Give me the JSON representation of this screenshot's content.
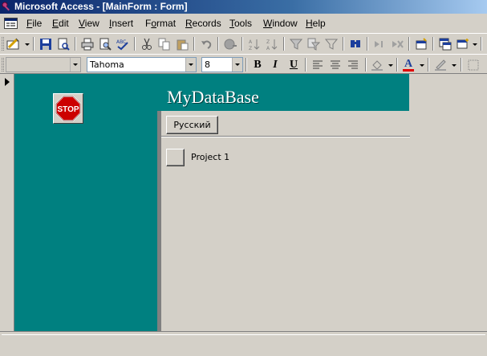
{
  "window": {
    "title": "Microsoft Access - [MainForm : Form]"
  },
  "menu": {
    "items": [
      {
        "label": "File",
        "underline": "F",
        "rest": "ile"
      },
      {
        "label": "Edit",
        "underline": "E",
        "rest": "dit"
      },
      {
        "label": "View",
        "underline": "V",
        "rest": "iew"
      },
      {
        "label": "Insert",
        "underline": "I",
        "rest": "nsert"
      },
      {
        "label": "Format",
        "pre": "F",
        "underline": "o",
        "rest": "rmat"
      },
      {
        "label": "Records",
        "underline": "R",
        "rest": "ecords"
      },
      {
        "label": "Tools",
        "underline": "T",
        "rest": "ools"
      },
      {
        "label": "Window",
        "underline": "W",
        "rest": "indow"
      },
      {
        "label": "Help",
        "underline": "H",
        "rest": "elp"
      }
    ]
  },
  "format_toolbar": {
    "object_combo": "",
    "font_name": "Tahoma",
    "font_size": "8",
    "bold": "B",
    "italic": "I",
    "underline": "U",
    "font_color_glyph": "A"
  },
  "form": {
    "title": "MyDataBase",
    "stop_label": "STOP",
    "language_button": "Русский",
    "project_label": "Project 1"
  },
  "colors": {
    "form_background": "#008080",
    "stop_red": "#cc0000",
    "title_bar_start": "#0a246a"
  }
}
